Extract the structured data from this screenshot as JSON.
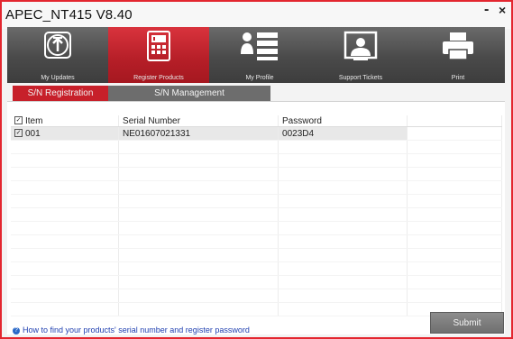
{
  "window": {
    "title": "APEC_NT415  V8.40",
    "minimize": "-",
    "close": "×"
  },
  "toolbar": {
    "items": [
      {
        "label": "My Updates",
        "icon": "upload-box-icon"
      },
      {
        "label": "Register Products",
        "icon": "calculator-icon",
        "active": true
      },
      {
        "label": "My Profile",
        "icon": "profile-list-icon"
      },
      {
        "label": "Support Tickets",
        "icon": "support-person-icon"
      },
      {
        "label": "Print",
        "icon": "printer-icon"
      }
    ]
  },
  "subtabs": {
    "registration": "S/N Registration",
    "management": "S/N Management"
  },
  "table": {
    "headers": [
      "Item",
      "Serial Number",
      "Password",
      ""
    ],
    "rows": [
      {
        "item": "001",
        "serial": "NE01607021331",
        "password": "0023D4",
        "checked": true
      }
    ]
  },
  "footer": {
    "help_text": "How to find your products' serial number and register password",
    "submit": "Submit"
  },
  "colors": {
    "accent": "#c7202a",
    "toolbar": "#4a4a4a",
    "link": "#1f3fb0"
  }
}
